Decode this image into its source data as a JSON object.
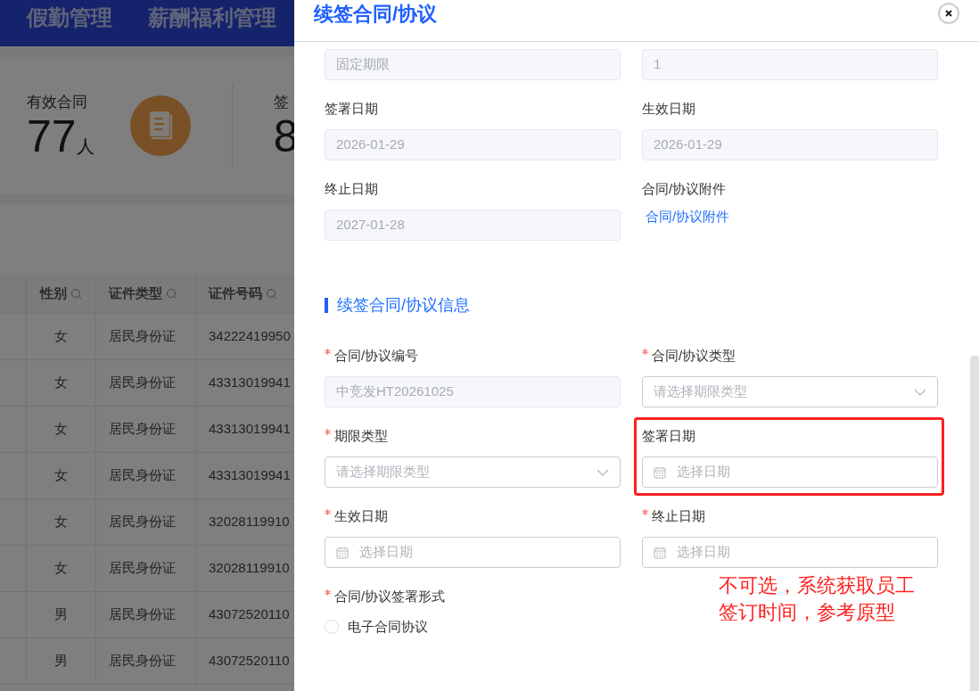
{
  "background": {
    "nav": [
      "假勤管理",
      "薪酬福利管理"
    ],
    "stats": [
      {
        "label": "有效合同",
        "value": "77",
        "unit": "人"
      },
      {
        "label": "签",
        "value": "8"
      }
    ],
    "table": {
      "columns": [
        "性别",
        "证件类型",
        "证件号码"
      ],
      "rows": [
        [
          "女",
          "居民身份证",
          "34222419950"
        ],
        [
          "女",
          "居民身份证",
          "43313019941"
        ],
        [
          "女",
          "居民身份证",
          "43313019941"
        ],
        [
          "女",
          "居民身份证",
          "43313019941"
        ],
        [
          "女",
          "居民身份证",
          "32028119910"
        ],
        [
          "女",
          "居民身份证",
          "32028119910"
        ],
        [
          "男",
          "居民身份证",
          "43072520110"
        ],
        [
          "男",
          "居民身份证",
          "43072520110"
        ]
      ]
    }
  },
  "drawer": {
    "title": "续签合同/协议",
    "current_fields": [
      {
        "kind": "input",
        "value": "固定期限",
        "disabled": true
      },
      {
        "kind": "input",
        "value": "1",
        "disabled": true
      },
      {
        "kind": "input",
        "label": "签署日期",
        "value": "2026-01-29",
        "disabled": true
      },
      {
        "kind": "input",
        "label": "生效日期",
        "value": "2026-01-29",
        "disabled": true
      },
      {
        "kind": "input",
        "label": "终止日期",
        "value": "2027-01-28",
        "disabled": true
      },
      {
        "kind": "link",
        "label": "合同/协议附件",
        "link": "合同/协议附件"
      }
    ],
    "section_title": "续签合同/协议信息",
    "renewal_fields": [
      {
        "kind": "input",
        "label": "合同/协议编号",
        "required": true,
        "value": "中竞发HT20261025",
        "disabled": true
      },
      {
        "kind": "select",
        "label": "合同/协议类型",
        "required": true,
        "placeholder": "请选择期限类型",
        "disabled": false
      },
      {
        "kind": "select",
        "label": "期限类型",
        "required": true,
        "placeholder": "请选择期限类型",
        "disabled": false
      },
      {
        "kind": "date",
        "label": "签署日期",
        "required": false,
        "placeholder": "选择日期",
        "disabled": false,
        "highlighted": true
      },
      {
        "kind": "date",
        "label": "生效日期",
        "required": true,
        "placeholder": "选择日期",
        "disabled": false
      },
      {
        "kind": "date",
        "label": "终止日期",
        "required": true,
        "placeholder": "选择日期",
        "disabled": false
      }
    ],
    "signing_form": {
      "label": "合同/协议签署形式",
      "required": true,
      "options": [
        {
          "label": "电子合同协议",
          "selected": false
        }
      ]
    },
    "annotation": "不可选，系统获取员工签订时间，参考原型"
  }
}
